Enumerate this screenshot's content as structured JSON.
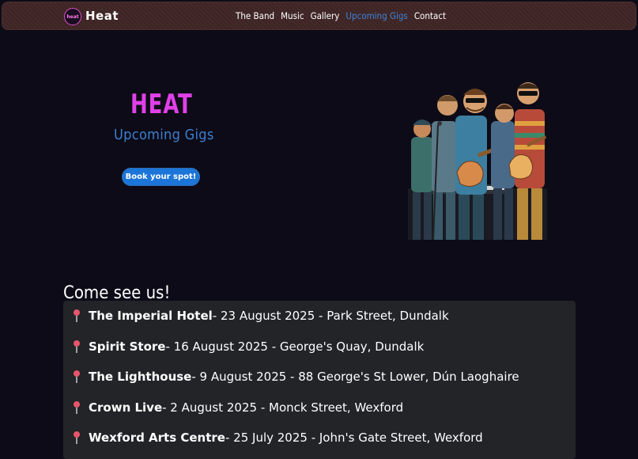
{
  "header": {
    "logo_text": "heat",
    "brand": "Heat",
    "nav": [
      {
        "label": "The Band"
      },
      {
        "label": "Music"
      },
      {
        "label": "Gallery"
      },
      {
        "label": "Upcoming Gigs"
      },
      {
        "label": "Contact"
      }
    ]
  },
  "hero": {
    "title": "HEAT",
    "subtitle": "Upcoming Gigs",
    "button_label": "Book your spot!"
  },
  "gigs_section": {
    "heading": "Come see us!",
    "items": [
      {
        "venue": "The Imperial Hotel",
        "details": " - 23 August 2025 - Park Street, Dundalk"
      },
      {
        "venue": "Spirit Store",
        "details": " - 16 August 2025 - George's Quay, Dundalk"
      },
      {
        "venue": "The Lighthouse",
        "details": " - 9 August 2025 - 88 George's St Lower, Dún Laoghaire"
      },
      {
        "venue": "Crown Live",
        "details": " - 2 August 2025 - Monck Street, Wexford"
      },
      {
        "venue": "Wexford Arts Centre",
        "details": " - 25 July 2025 - John's Gate Street, Wexford"
      }
    ]
  },
  "colors": {
    "background": "#0d0b17",
    "accent_pink": "#e040e8",
    "accent_blue": "#3b7fd0",
    "button": "#1c75d8",
    "nav_active": "#3b82d9",
    "list_bg": "#232428"
  },
  "icons": {
    "pin": "pin-icon",
    "logo": "heat-logo-icon"
  }
}
